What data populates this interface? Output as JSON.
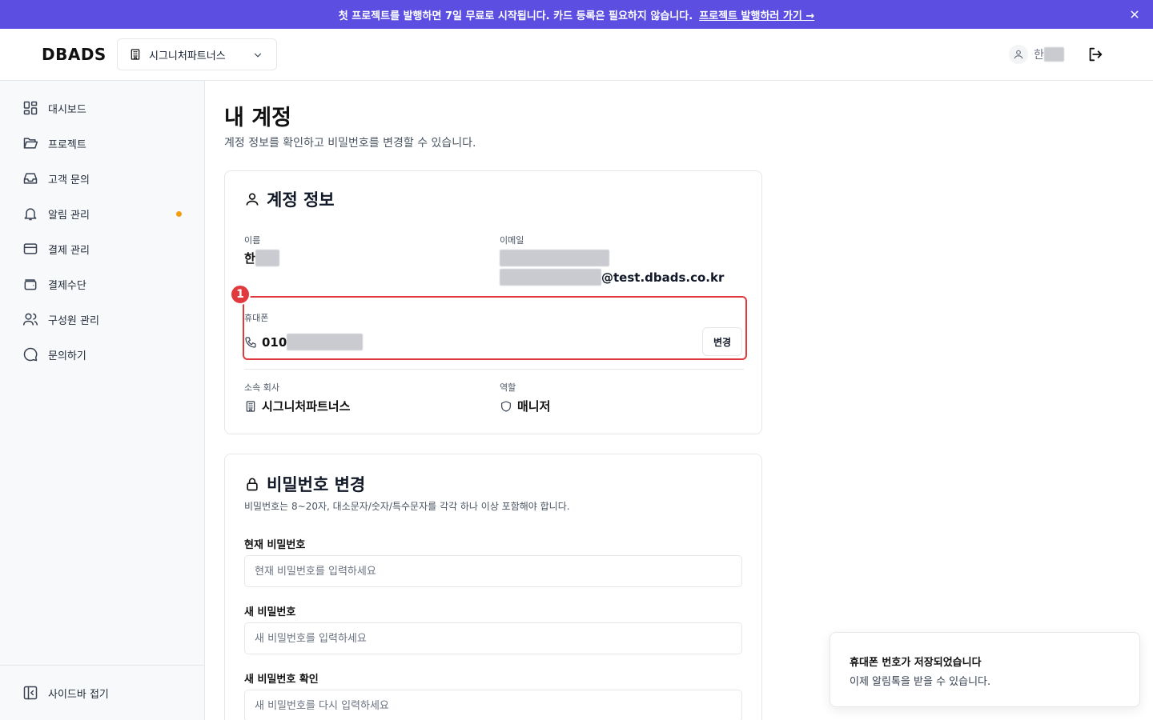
{
  "banner": {
    "text": "첫 프로젝트를 발행하면 7일 무료로 시작됩니다. 카드 등록은 필요하지 않습니다.",
    "link": "프로젝트 발행하러 가기 →",
    "close_icon": "close-icon"
  },
  "header": {
    "logo": "DBADS",
    "company": "시그니처파트너스",
    "user_name": "한"
  },
  "sidebar": {
    "items": [
      {
        "label": "대시보드",
        "icon": "dashboard-grid-icon"
      },
      {
        "label": "프로젝트",
        "icon": "folder-open-icon"
      },
      {
        "label": "고객 문의",
        "icon": "inbox-icon"
      },
      {
        "label": "알림 관리",
        "icon": "bell-icon"
      },
      {
        "label": "결제 관리",
        "icon": "credit-card-icon"
      },
      {
        "label": "결제수단",
        "icon": "wallet-icon"
      },
      {
        "label": "구성원 관리",
        "icon": "users-icon"
      },
      {
        "label": "문의하기",
        "icon": "chat-bubble-icon"
      }
    ],
    "collapse": "사이드바 접기",
    "notification_dot_color": "#f59e0b"
  },
  "page": {
    "title": "내 계정",
    "desc": "계정 정보를 확인하고 비밀번호를 변경할 수 있습니다."
  },
  "account": {
    "title": "계정 정보",
    "name_label": "이름",
    "name_value": "한",
    "email_label": "이메일",
    "email_domain": "@test.dbads.co.kr",
    "phone_label": "휴대폰",
    "phone_prefix": "010",
    "change_button": "변경",
    "badge": "1",
    "company_label": "소속 회사",
    "company_value": "시그니처파트너스",
    "role_label": "역할",
    "role_value": "매니저"
  },
  "password": {
    "title": "비밀번호 변경",
    "desc": "비밀번호는 8~20자, 대소문자/숫자/특수문자를 각각 하나 이상 포함해야 합니다.",
    "current_label": "현재 비밀번호",
    "current_placeholder": "현재 비밀번호를 입력하세요",
    "new_label": "새 비밀번호",
    "new_placeholder": "새 비밀번호를 입력하세요",
    "confirm_label": "새 비밀번호 확인",
    "confirm_placeholder": "새 비밀번호를 다시 입력하세요"
  },
  "toast": {
    "title": "휴대폰 번호가 저장되었습니다",
    "desc": "이제 알림톡을 받을 수 있습니다."
  },
  "colors": {
    "banner_bg": "#5b4ee0",
    "highlight": "#e0393e"
  }
}
